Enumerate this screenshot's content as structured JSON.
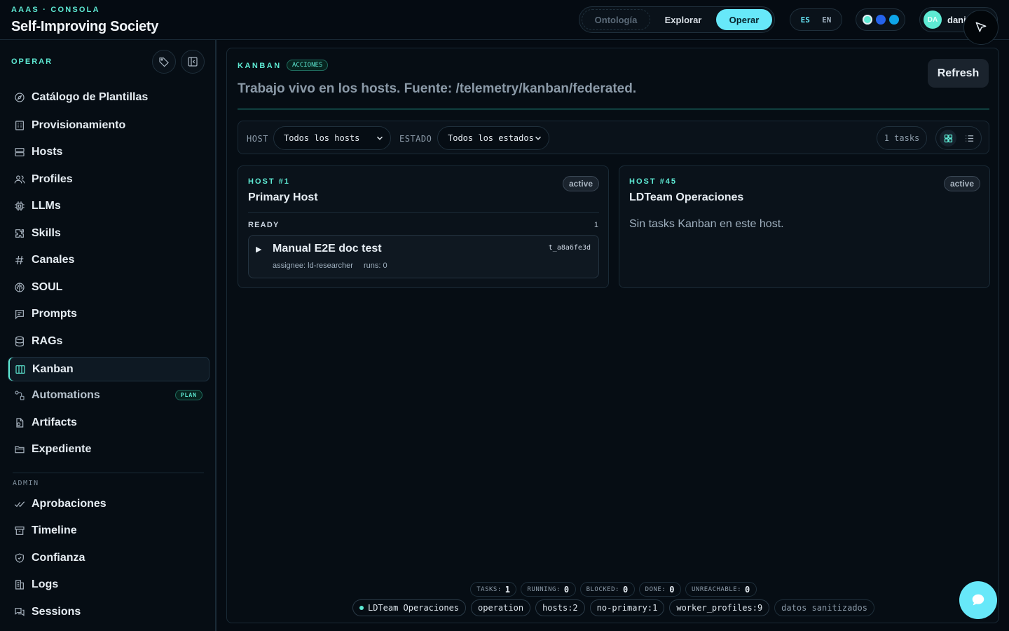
{
  "header": {
    "eyebrow": "AAAS · CONSOLA",
    "title": "Self-Improving Society",
    "modes": [
      "Ontología",
      "Explorar",
      "Operar"
    ],
    "languages": [
      "ES",
      "EN"
    ],
    "theme_colors": [
      "#5eead4",
      "#2563eb",
      "#0ea5e9"
    ],
    "user": {
      "initials": "DA",
      "name": "dani"
    }
  },
  "sidebar": {
    "section": "OPERAR",
    "items": [
      {
        "label": "Catálogo de Plantillas",
        "icon": "compass-icon"
      },
      {
        "label": "Provisionamiento",
        "icon": "building-icon"
      },
      {
        "label": "Hosts",
        "icon": "server-icon"
      },
      {
        "label": "Profiles",
        "icon": "users-icon"
      },
      {
        "label": "LLMs",
        "icon": "cpu-icon"
      },
      {
        "label": "Skills",
        "icon": "puzzle-icon"
      },
      {
        "label": "Canales",
        "icon": "channels-icon"
      },
      {
        "label": "SOUL",
        "icon": "brain-icon"
      },
      {
        "label": "Prompts",
        "icon": "message-icon"
      },
      {
        "label": "RAGs",
        "icon": "database-icon"
      },
      {
        "label": "Kanban",
        "icon": "kanban-icon"
      },
      {
        "label": "Automations",
        "icon": "workflow-icon",
        "badge": "PLAN"
      },
      {
        "label": "Artifacts",
        "icon": "file-icon"
      },
      {
        "label": "Expediente",
        "icon": "folder-icon"
      }
    ],
    "admin_section": "ADMIN",
    "admin_items": [
      {
        "label": "Aprobaciones",
        "icon": "check-double-icon"
      },
      {
        "label": "Timeline",
        "icon": "archive-icon"
      },
      {
        "label": "Confianza",
        "icon": "shield-icon"
      },
      {
        "label": "Logs",
        "icon": "logs-icon"
      },
      {
        "label": "Sessions",
        "icon": "chat-icon"
      }
    ]
  },
  "kanban": {
    "eyebrow": "KANBAN",
    "badge": "ACCIONES",
    "subtitle": "Trabajo vivo en los hosts. Fuente: /telemetry/kanban/federated.",
    "refresh_label": "Refresh",
    "filters": {
      "host_label": "HOST",
      "host_value": "Todos los hosts",
      "state_label": "ESTADO",
      "state_value": "Todos los estados",
      "count": "1 tasks"
    },
    "hosts": [
      {
        "eyebrow": "HOST #1",
        "name": "Primary Host",
        "status": "active",
        "column": "READY",
        "column_count": "1",
        "task": {
          "title": "Manual E2E doc test",
          "id": "t_a8a6fe3d",
          "assignee": "assignee: ld-researcher",
          "runs": "runs: 0"
        }
      },
      {
        "eyebrow": "HOST #45",
        "name": "LDTeam Operaciones",
        "status": "active",
        "empty": "Sin tasks Kanban en este host."
      }
    ],
    "stats": [
      {
        "label": "TASKS:",
        "value": "1"
      },
      {
        "label": "RUNNING:",
        "value": "0"
      },
      {
        "label": "BLOCKED:",
        "value": "0"
      },
      {
        "label": "DONE:",
        "value": "0"
      },
      {
        "label": "UNREACHABLE:",
        "value": "0"
      }
    ],
    "tags": [
      "LDTeam Operaciones",
      "operation",
      "hosts:2",
      "no-primary:1",
      "worker_profiles:9",
      "datos sanitizados"
    ]
  }
}
